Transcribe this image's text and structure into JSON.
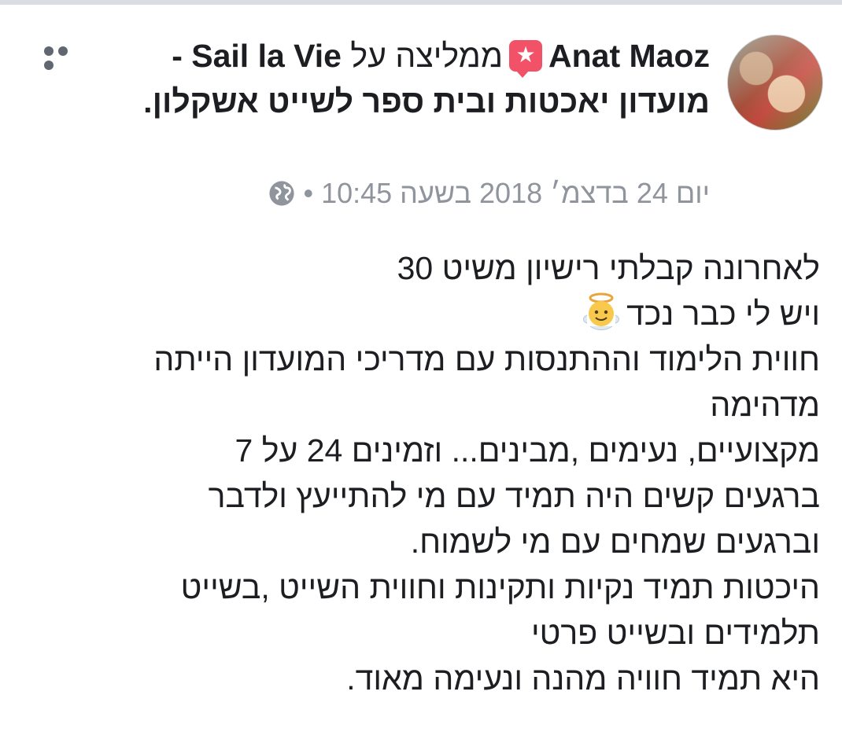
{
  "post": {
    "author": "Anat Maoz",
    "action_text": "ממליצה על",
    "page_name": "Sail la Vie - מועדון יאכטות ובית ספר לשייט אשקלון",
    "timestamp": "יום 24 בדצמ׳ 2018 בשעה 10:45",
    "separator": "•",
    "privacy_icon": "globe-icon",
    "recommend_icon": "star-speech-bubble-icon",
    "more_icon": "ellipsis-icon",
    "body_lines": [
      "לאחרונה קבלתי רישיון משיט 30",
      "ויש לי כבר נכד",
      "חווית הלימוד וההתנסות עם מדריכי המועדון הייתה",
      "מדהימה",
      "מקצועיים, נעימים ,מבינים...  וזמינים 24 על 7",
      "ברגעים קשים היה תמיד עם מי להתייעץ ולדבר",
      "וברגעים שמחים עם מי לשמוח.",
      "היכטות תמיד נקיות ותקינות וחווית השייט ,בשייט",
      "תלמידים  ובשייט פרטי",
      "היא תמיד חוויה מהנה ונעימה מאוד."
    ],
    "emoji": "angel-emoji"
  },
  "colors": {
    "text": "#1c1e21",
    "meta": "#90949c",
    "recommend": "#f25268",
    "divider": "#dadde1"
  }
}
